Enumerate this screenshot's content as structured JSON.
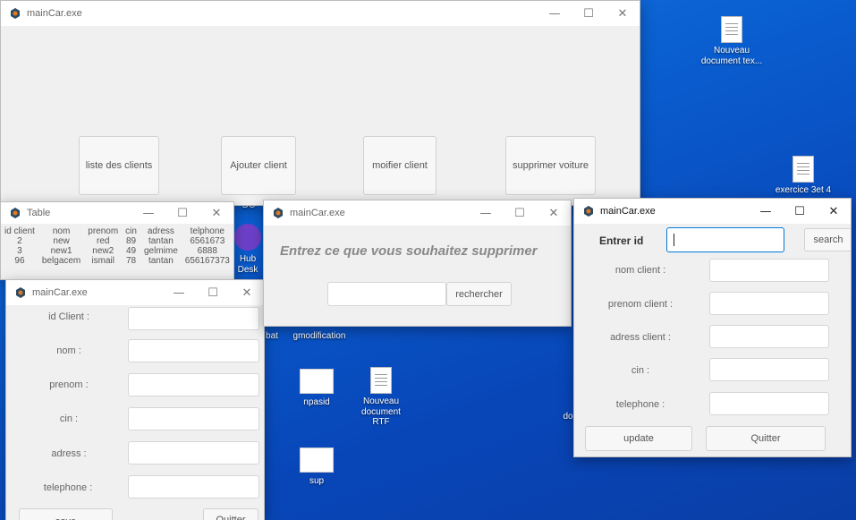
{
  "desktop": {
    "icons": {
      "nouveau_doc_txt": "Nouveau document tex...",
      "exercice": "exercice 3et 4",
      "dc": "DC",
      "github": "Hub Desk",
      "bat": "bat",
      "gmodification": "gmodification",
      "npasid": "npasid",
      "nouveau_rtf": "Nouveau document RTF",
      "do": "do",
      "sup": "sup"
    }
  },
  "main_window": {
    "title": "mainCar.exe",
    "buttons": {
      "list_clients": "liste des clients",
      "add_client": "Ajouter client",
      "modify_client": "moifier client",
      "delete_car": "supprimer voiture"
    }
  },
  "table_window": {
    "title": "Table",
    "columns": [
      "id client",
      "nom",
      "prenom",
      "cin",
      "adress",
      "telphone"
    ],
    "rows": [
      [
        "2",
        "new",
        "red",
        "89",
        "tantan",
        "6561673"
      ],
      [
        "3",
        "new1",
        "new2",
        "49",
        "gelmime",
        "6888"
      ],
      [
        "96",
        "belgacem",
        "ismail",
        "78",
        "tantan",
        "656167373"
      ]
    ]
  },
  "add_window": {
    "title": "mainCar.exe",
    "labels": {
      "id": "id Client :",
      "nom": "nom :",
      "prenom": "prenom :",
      "cin": "cin :",
      "adress": "adress :",
      "telephone": "telephone :"
    },
    "save_label": "save",
    "quit_label": "Quitter"
  },
  "delete_window": {
    "title": "mainCar.exe",
    "prompt": "Entrez ce que vous souhaitez supprimer",
    "search_label": "rechercher"
  },
  "update_window": {
    "title": "mainCar.exe",
    "id_label": "Entrer id",
    "search_label": "search",
    "labels": {
      "nom": "nom client  :",
      "prenom": "prenom client :",
      "adress": "adress client :",
      "cin": "cin :",
      "telephone": "telephone :"
    },
    "update_label": "update",
    "quit_label": "Quitter"
  },
  "window_controls": {
    "minimize": "—",
    "maximize": "☐",
    "close": "✕"
  },
  "colors": {
    "desktop_blue": "#0a5fd1",
    "field_focus": "#0078d7"
  }
}
